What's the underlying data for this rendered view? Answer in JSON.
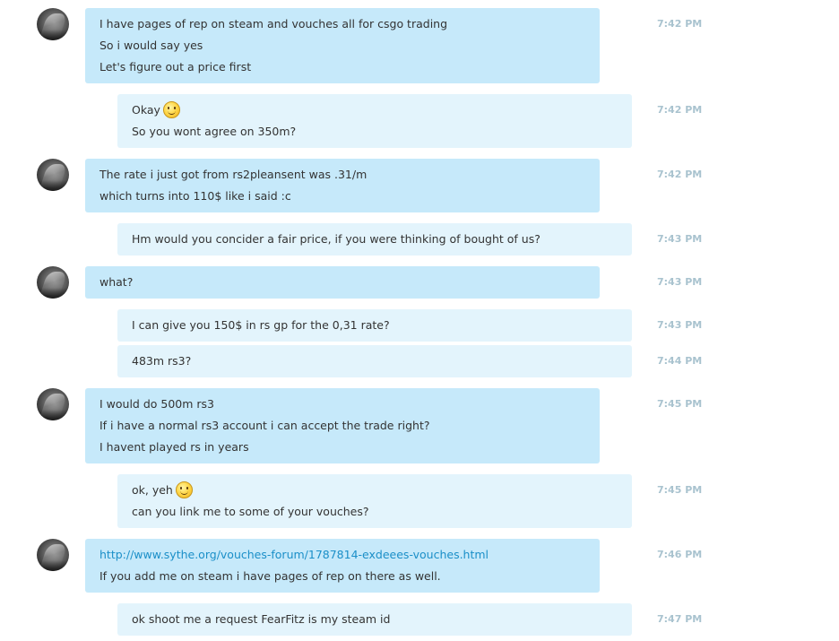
{
  "messages": [
    {
      "from": "them",
      "time": "7:42 PM",
      "lines": [
        "I have pages of rep on steam and vouches all for csgo trading",
        "So i would say yes",
        "Let's figure out a price first"
      ]
    },
    {
      "from": "me",
      "time": "7:42 PM",
      "lines": [
        "Okay",
        "So you wont agree on 350m?"
      ]
    },
    {
      "from": "them",
      "time": "7:42 PM",
      "lines": [
        "The rate i just got from rs2pleansent was .31/m",
        "which turns into 110$ like i said :c"
      ]
    },
    {
      "from": "me",
      "time": "7:43 PM",
      "lines": [
        "Hm would you concider a fair price, if you were thinking of bought of us?"
      ]
    },
    {
      "from": "them",
      "time": "7:43 PM",
      "lines": [
        "what?"
      ]
    },
    {
      "from": "me",
      "time": "7:43 PM",
      "lines": [
        "I can give you 150$ in rs gp for the 0,31 rate?"
      ]
    },
    {
      "from": "me",
      "time": "7:44 PM",
      "lines": [
        "483m rs3?"
      ]
    },
    {
      "from": "them",
      "time": "7:45 PM",
      "lines": [
        "I would do 500m rs3",
        "If i have a normal rs3 account i can accept the trade right?",
        "I havent played rs in years"
      ]
    },
    {
      "from": "me",
      "time": "7:45 PM",
      "lines": [
        "ok, yeh",
        "can you link me to some of your vouches?"
      ]
    },
    {
      "from": "them",
      "time": "7:46 PM",
      "lines": [
        "http://www.sythe.org/vouches-forum/1787814-exdeees-vouches.html",
        "If you add me on steam i have pages of rep on there as well."
      ]
    },
    {
      "from": "me",
      "time": "7:47 PM",
      "lines": [
        "ok shoot me a request FearFitz is my steam id"
      ]
    }
  ],
  "emoticons": {
    "smile": "smile-emoticon"
  },
  "colors": {
    "them_bubble": "#c6e9fa",
    "me_bubble": "#e3f4fc",
    "link": "#1b8fc8",
    "timestamp": "#a9c3cf"
  }
}
